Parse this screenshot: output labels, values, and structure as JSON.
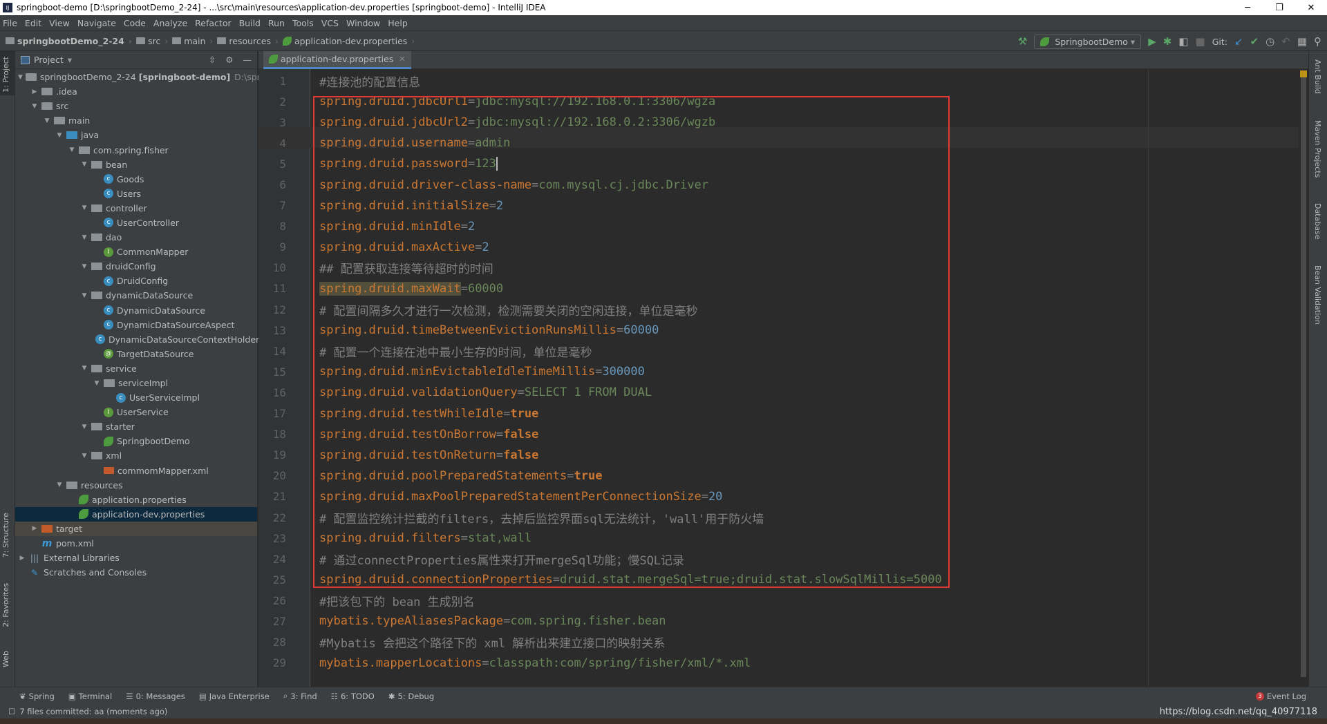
{
  "window": {
    "title": "springboot-demo [D:\\springbootDemo_2-24] - ...\\src\\main\\resources\\application-dev.properties [springboot-demo] - IntelliJ IDEA",
    "minimize": "─",
    "maximize": "❐",
    "close": "✕"
  },
  "menu": [
    "File",
    "Edit",
    "View",
    "Navigate",
    "Code",
    "Analyze",
    "Refactor",
    "Build",
    "Run",
    "Tools",
    "VCS",
    "Window",
    "Help"
  ],
  "breadcrumbs": [
    "springbootDemo_2-24",
    "src",
    "main",
    "resources",
    "application-dev.properties"
  ],
  "toolbar": {
    "run_config": "SpringbootDemo",
    "git_label": "Git:"
  },
  "left_strip": {
    "project": "1: Project",
    "structure": "7: Structure",
    "favorites": "2: Favorites",
    "web": "Web"
  },
  "right_strip": [
    "Ant Build",
    "Maven Projects",
    "Database",
    "Bean Validation"
  ],
  "project_panel": {
    "title": "Project",
    "tree": [
      {
        "level": 0,
        "arrow": "down",
        "icon": "module",
        "label": "springbootDemo_2-24",
        "bold": "[springboot-demo]",
        "dim": "D:\\spring"
      },
      {
        "level": 1,
        "arrow": "right",
        "icon": "folder",
        "label": ".idea"
      },
      {
        "level": 1,
        "arrow": "down",
        "icon": "folder",
        "label": "src"
      },
      {
        "level": 2,
        "arrow": "down",
        "icon": "folder",
        "label": "main"
      },
      {
        "level": 3,
        "arrow": "down",
        "icon": "src",
        "label": "java"
      },
      {
        "level": 4,
        "arrow": "down",
        "icon": "pkg",
        "label": "com.spring.fisher"
      },
      {
        "level": 5,
        "arrow": "down",
        "icon": "pkg",
        "label": "bean"
      },
      {
        "level": 6,
        "arrow": "",
        "icon": "cls",
        "label": "Goods"
      },
      {
        "level": 6,
        "arrow": "",
        "icon": "cls",
        "label": "Users"
      },
      {
        "level": 5,
        "arrow": "down",
        "icon": "pkg",
        "label": "controller"
      },
      {
        "level": 6,
        "arrow": "",
        "icon": "cls",
        "label": "UserController"
      },
      {
        "level": 5,
        "arrow": "down",
        "icon": "pkg",
        "label": "dao"
      },
      {
        "level": 6,
        "arrow": "",
        "icon": "intf",
        "label": "CommonMapper"
      },
      {
        "level": 5,
        "arrow": "down",
        "icon": "pkg",
        "label": "druidConfig"
      },
      {
        "level": 6,
        "arrow": "",
        "icon": "cls",
        "label": "DruidConfig"
      },
      {
        "level": 5,
        "arrow": "down",
        "icon": "pkg",
        "label": "dynamicDataSource"
      },
      {
        "level": 6,
        "arrow": "",
        "icon": "cls",
        "label": "DynamicDataSource"
      },
      {
        "level": 6,
        "arrow": "",
        "icon": "cls",
        "label": "DynamicDataSourceAspect"
      },
      {
        "level": 6,
        "arrow": "",
        "icon": "cls",
        "label": "DynamicDataSourceContextHolder"
      },
      {
        "level": 6,
        "arrow": "",
        "icon": "anno",
        "label": "TargetDataSource"
      },
      {
        "level": 5,
        "arrow": "down",
        "icon": "pkg",
        "label": "service"
      },
      {
        "level": 6,
        "arrow": "down",
        "icon": "pkg",
        "label": "serviceImpl"
      },
      {
        "level": 7,
        "arrow": "",
        "icon": "cls",
        "label": "UserServiceImpl"
      },
      {
        "level": 6,
        "arrow": "",
        "icon": "intf",
        "label": "UserService"
      },
      {
        "level": 5,
        "arrow": "down",
        "icon": "pkg",
        "label": "starter"
      },
      {
        "level": 6,
        "arrow": "",
        "icon": "spring",
        "label": "SpringbootDemo"
      },
      {
        "level": 5,
        "arrow": "down",
        "icon": "pkg",
        "label": "xml"
      },
      {
        "level": 6,
        "arrow": "",
        "icon": "xml",
        "label": "commomMapper.xml"
      },
      {
        "level": 3,
        "arrow": "down",
        "icon": "folder",
        "label": "resources"
      },
      {
        "level": 4,
        "arrow": "",
        "icon": "spring",
        "label": "application.properties"
      },
      {
        "level": 4,
        "arrow": "",
        "icon": "spring",
        "label": "application-dev.properties",
        "selected": true
      },
      {
        "level": 1,
        "arrow": "right",
        "icon": "target",
        "label": "target",
        "excluded": true
      },
      {
        "level": 1,
        "arrow": "",
        "icon": "maven",
        "label": "pom.xml"
      },
      {
        "level": 0,
        "arrow": "right",
        "icon": "lib",
        "label": "External Libraries"
      },
      {
        "level": 0,
        "arrow": "",
        "icon": "scratch",
        "label": "Scratches and Consoles"
      }
    ]
  },
  "editor": {
    "tab": "application-dev.properties",
    "current_line": 5,
    "lines": [
      [
        [
          "c",
          "#连接池的配置信息"
        ]
      ],
      [
        [
          "k",
          "spring.druid.jdbcUrl1"
        ],
        [
          "c",
          "="
        ],
        [
          "v",
          "jdbc:mysql://192.168.0.1:3306/wgza"
        ]
      ],
      [
        [
          "k",
          "spring.druid.jdbcUrl2"
        ],
        [
          "c",
          "="
        ],
        [
          "v",
          "jdbc:mysql://192.168.0.2:3306/wgzb"
        ]
      ],
      [
        [
          "k",
          "spring.druid.username"
        ],
        [
          "c",
          "="
        ],
        [
          "v",
          "admin"
        ]
      ],
      [
        [
          "k",
          "spring.druid.password"
        ],
        [
          "c",
          "="
        ],
        [
          "v caret",
          "123"
        ]
      ],
      [
        [
          "k",
          "spring.druid.driver-class-name"
        ],
        [
          "c",
          "="
        ],
        [
          "v",
          "com.mysql.cj.jdbc.Driver"
        ]
      ],
      [
        [
          "k",
          "spring.druid.initialSize"
        ],
        [
          "c",
          "="
        ],
        [
          "n",
          "2"
        ]
      ],
      [
        [
          "k",
          "spring.druid.minIdle"
        ],
        [
          "c",
          "="
        ],
        [
          "n",
          "2"
        ]
      ],
      [
        [
          "k",
          "spring.druid.maxActive"
        ],
        [
          "c",
          "="
        ],
        [
          "n",
          "2"
        ]
      ],
      [
        [
          "c",
          "## 配置获取连接等待超时的时间"
        ]
      ],
      [
        [
          "k hl",
          "spring.druid.maxWait"
        ],
        [
          "c",
          "="
        ],
        [
          "v",
          "60000"
        ]
      ],
      [
        [
          "c",
          "# 配置间隔多久才进行一次检测，检测需要关闭的空闲连接，单位是毫秒"
        ]
      ],
      [
        [
          "k",
          "spring.druid.timeBetweenEvictionRunsMillis"
        ],
        [
          "c",
          "="
        ],
        [
          "n",
          "60000"
        ]
      ],
      [
        [
          "c",
          "# 配置一个连接在池中最小生存的时间，单位是毫秒"
        ]
      ],
      [
        [
          "k",
          "spring.druid.minEvictableIdleTimeMillis"
        ],
        [
          "c",
          "="
        ],
        [
          "n",
          "300000"
        ]
      ],
      [
        [
          "k",
          "spring.druid.validationQuery"
        ],
        [
          "c",
          "="
        ],
        [
          "v",
          "SELECT 1 FROM DUAL"
        ]
      ],
      [
        [
          "k",
          "spring.druid.testWhileIdle"
        ],
        [
          "c",
          "="
        ],
        [
          "kw",
          "true"
        ]
      ],
      [
        [
          "k",
          "spring.druid.testOnBorrow"
        ],
        [
          "c",
          "="
        ],
        [
          "kw",
          "false"
        ]
      ],
      [
        [
          "k",
          "spring.druid.testOnReturn"
        ],
        [
          "c",
          "="
        ],
        [
          "kw",
          "false"
        ]
      ],
      [
        [
          "k",
          "spring.druid.poolPreparedStatements"
        ],
        [
          "c",
          "="
        ],
        [
          "kw",
          "true"
        ]
      ],
      [
        [
          "k",
          "spring.druid.maxPoolPreparedStatementPerConnectionSize"
        ],
        [
          "c",
          "="
        ],
        [
          "n",
          "20"
        ]
      ],
      [
        [
          "c",
          "# 配置监控统计拦截的filters，去掉后监控界面sql无法统计，'wall'用于防火墙"
        ]
      ],
      [
        [
          "k",
          "spring.druid.filters"
        ],
        [
          "c",
          "="
        ],
        [
          "v",
          "stat,wall"
        ]
      ],
      [
        [
          "c",
          "# 通过connectProperties属性来打开mergeSql功能；慢SQL记录"
        ]
      ],
      [
        [
          "k",
          "spring.druid.connectionProperties"
        ],
        [
          "c",
          "="
        ],
        [
          "v",
          "druid.stat.mergeSql=true;druid.stat.slowSqlMillis=5000"
        ]
      ],
      [
        [
          "c",
          "#把该包下的 bean 生成别名"
        ]
      ],
      [
        [
          "k",
          "mybatis.typeAliasesPackage"
        ],
        [
          "c",
          "="
        ],
        [
          "v",
          "com.spring.fisher.bean"
        ]
      ],
      [
        [
          "c",
          "#Mybatis 会把这个路径下的 xml 解析出来建立接口的映射关系"
        ]
      ],
      [
        [
          "k",
          "mybatis.mapperLocations"
        ],
        [
          "c",
          "="
        ],
        [
          "v",
          "classpath:com/spring/fisher/xml/*.xml"
        ]
      ]
    ]
  },
  "bottom_tools": [
    {
      "icon": "spring-icon",
      "glyph": "❦",
      "label": "Spring"
    },
    {
      "icon": "terminal-icon",
      "glyph": "▣",
      "label": "Terminal"
    },
    {
      "icon": "messages-icon",
      "glyph": "☰",
      "label": "0: Messages"
    },
    {
      "icon": "java-enterprise-icon",
      "glyph": "▤",
      "label": "Java Enterprise"
    },
    {
      "icon": "find-icon",
      "glyph": "⌕",
      "label": "3: Find"
    },
    {
      "icon": "todo-icon",
      "glyph": "☷",
      "label": "6: TODO"
    },
    {
      "icon": "debug-icon",
      "glyph": "✱",
      "label": "5: Debug"
    }
  ],
  "event_log": {
    "label": "Event Log",
    "count": "3"
  },
  "status": {
    "message": "7 files committed: aa (moments ago)",
    "watermark": "https://blog.csdn.net/qq_40977118"
  },
  "colors": {
    "key": "#cc7832",
    "value": "#6a8759",
    "number": "#6897bb",
    "comment": "#808080",
    "highlight_box": "#e53935"
  }
}
